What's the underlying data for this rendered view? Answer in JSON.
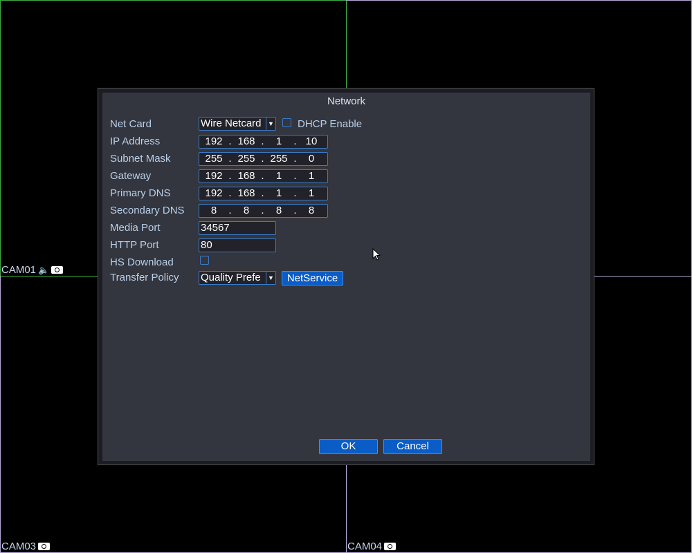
{
  "cameras": [
    {
      "label": "CAM01"
    },
    {
      "label": "CAM03"
    },
    {
      "label": "CAM04"
    }
  ],
  "dialog": {
    "title": "Network",
    "fields": {
      "net_card": {
        "label": "Net Card",
        "value": "Wire Netcard"
      },
      "dhcp": {
        "label": "DHCP Enable",
        "checked": false
      },
      "ip": {
        "label": "IP Address",
        "octets": [
          "192",
          "168",
          "1",
          "10"
        ]
      },
      "mask": {
        "label": "Subnet Mask",
        "octets": [
          "255",
          "255",
          "255",
          "0"
        ]
      },
      "gateway": {
        "label": "Gateway",
        "octets": [
          "192",
          "168",
          "1",
          "1"
        ]
      },
      "dns1": {
        "label": "Primary DNS",
        "octets": [
          "192",
          "168",
          "1",
          "1"
        ]
      },
      "dns2": {
        "label": "Secondary DNS",
        "octets": [
          "8",
          "8",
          "8",
          "8"
        ]
      },
      "media_port": {
        "label": "Media Port",
        "value": "34567"
      },
      "http_port": {
        "label": "HTTP Port",
        "value": "80"
      },
      "hs_download": {
        "label": "HS Download",
        "checked": false
      },
      "transfer": {
        "label": "Transfer Policy",
        "value": "Quality Prefe"
      }
    },
    "netservice_label": "NetService",
    "ok_label": "OK",
    "cancel_label": "Cancel"
  }
}
